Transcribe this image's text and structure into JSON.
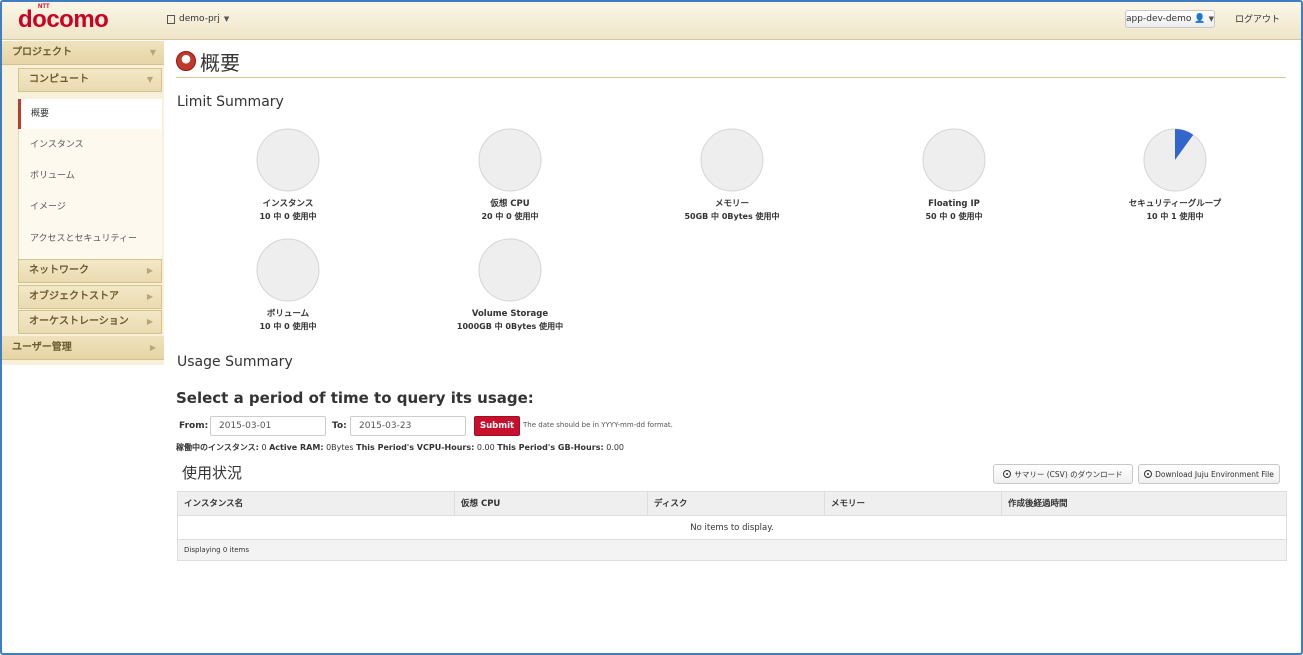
{
  "header": {
    "logo_text": "docomo",
    "logo_ntt": "NTT",
    "project": "demo-prj",
    "user": "app-dev-demo",
    "logout": "ログアウト"
  },
  "sidebar": {
    "project": "プロジェクト",
    "compute": "コンピュート",
    "items": [
      "概要",
      "インスタンス",
      "ボリューム",
      "イメージ",
      "アクセスとセキュリティー"
    ],
    "network": "ネットワーク",
    "object_store": "オブジェクトストア",
    "orchestration": "オーケストレーション",
    "user_mgmt": "ユーザー管理"
  },
  "main": {
    "title": "概要",
    "limit_summary": "Limit Summary",
    "usage_summary": "Usage Summary",
    "query_title": "Select a period of time to query its usage:",
    "from_label": "From:",
    "from_value": "2015-03-01",
    "to_label": "To:",
    "to_value": "2015-03-23",
    "submit": "Submit",
    "date_hint": "The date should be in YYYY-mm-dd format.",
    "usage_stats": {
      "active_instances_label": "稼働中のインスタンス:",
      "active_instances": "0",
      "active_ram_label": "Active RAM:",
      "active_ram": "0Bytes",
      "vcpu_hours_label": "This Period's VCPU-Hours:",
      "vcpu_hours": "0.00",
      "gb_hours_label": "This Period's GB-Hours:",
      "gb_hours": "0.00"
    },
    "usage_title": "使用状況",
    "csv_button": "サマリー (CSV) のダウンロード",
    "juju_button": "Download Juju Environment File",
    "table": {
      "columns": [
        "インスタンス名",
        "仮想 CPU",
        "ディスク",
        "メモリー",
        "作成後経過時間"
      ],
      "empty": "No items to display.",
      "footer": "Displaying 0 items"
    }
  },
  "colors": {
    "pie_bg": "#eeeeee",
    "pie_border": "#d4d4d4",
    "pie_fill": "#3366cc"
  },
  "limits": [
    {
      "label": "インスタンス",
      "usage": "10 中 0 使用中",
      "used_fraction": 0
    },
    {
      "label": "仮想 CPU",
      "usage": "20 中 0 使用中",
      "used_fraction": 0
    },
    {
      "label": "メモリー",
      "usage": "50GB 中 0Bytes 使用中",
      "used_fraction": 0
    },
    {
      "label": "Floating IP",
      "usage": "50 中 0 使用中",
      "used_fraction": 0
    },
    {
      "label": "セキュリティーグループ",
      "usage": "10 中 1 使用中",
      "used_fraction": 0.1
    },
    {
      "label": "ボリューム",
      "usage": "10 中 0 使用中",
      "used_fraction": 0
    },
    {
      "label": "Volume Storage",
      "usage": "1000GB 中 0Bytes 使用中",
      "used_fraction": 0
    }
  ]
}
